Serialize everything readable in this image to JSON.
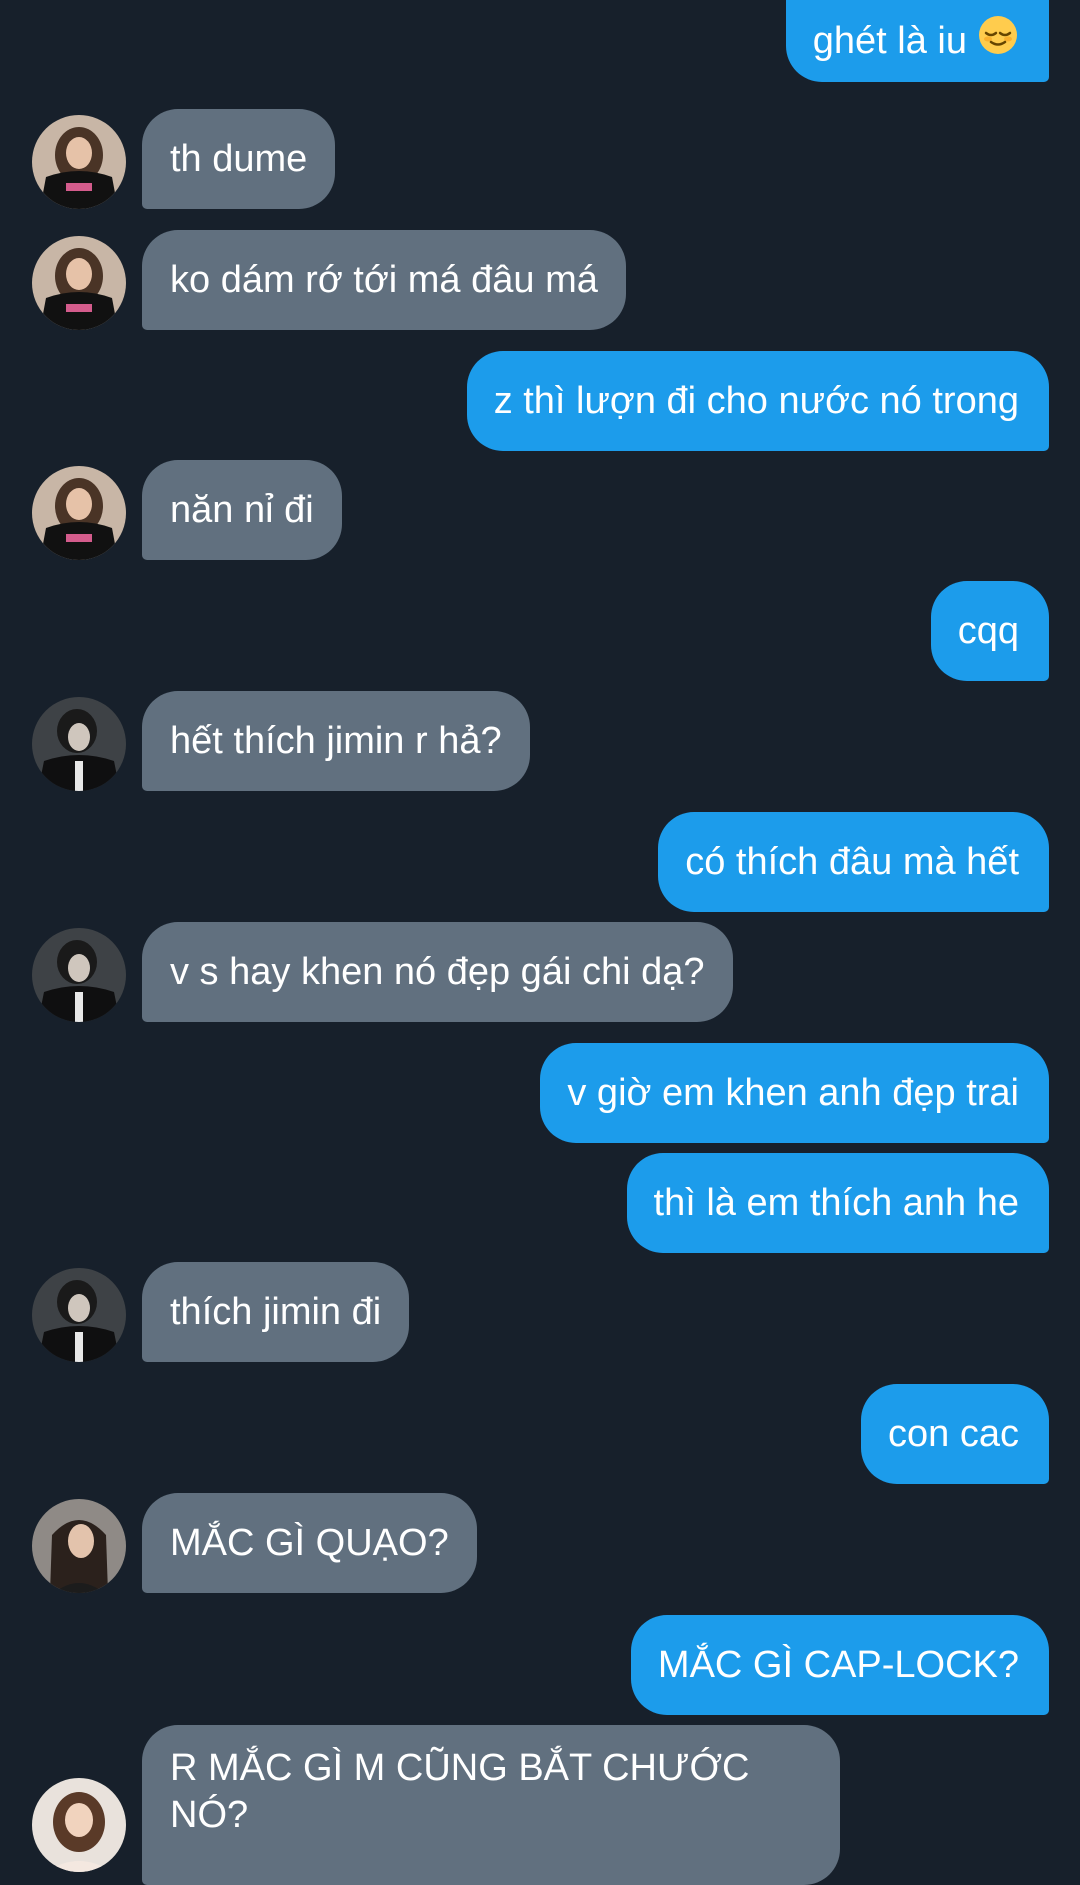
{
  "messages": [
    {
      "side": "out",
      "text": "ghét là iu",
      "emoji": "relieved-face"
    },
    {
      "side": "in",
      "avatar": "avatar-girl-black-shirt",
      "text": "th dume"
    },
    {
      "side": "in",
      "avatar": "avatar-girl-black-shirt",
      "text": "ko dám rớ tới má đâu má"
    },
    {
      "side": "out",
      "text": "z thì lượn đi cho nước nó trong"
    },
    {
      "side": "in",
      "avatar": "avatar-girl-black-shirt",
      "text": "năn nỉ đi"
    },
    {
      "side": "out",
      "text": "cqq"
    },
    {
      "side": "in",
      "avatar": "avatar-boy-dark-jacket",
      "text": "hết thích jimin r hả?"
    },
    {
      "side": "out",
      "text": "có thích đâu mà hết"
    },
    {
      "side": "in",
      "avatar": "avatar-boy-dark-jacket",
      "text": "v s hay khen nó đẹp gái chi dạ?"
    },
    {
      "side": "out",
      "text": "v giờ em khen anh đẹp trai"
    },
    {
      "side": "out",
      "text": "thì là em thích anh he"
    },
    {
      "side": "in",
      "avatar": "avatar-boy-dark-jacket",
      "text": "thích jimin đi"
    },
    {
      "side": "out",
      "text": "con cac"
    },
    {
      "side": "in",
      "avatar": "avatar-girl-long-hair",
      "text": "MẮC GÌ QUẠO?"
    },
    {
      "side": "out",
      "text": "MẮC GÌ CAP-LOCK?"
    },
    {
      "side": "in",
      "avatar": "avatar-girl-light-top",
      "text": "R MẮC GÌ M CŨNG BẮT CHƯỚC NÓ?"
    }
  ],
  "colors": {
    "background": "#17202b",
    "outgoing_bubble": "#1c9ceb",
    "incoming_bubble": "#61707f",
    "text": "#ffffff"
  }
}
